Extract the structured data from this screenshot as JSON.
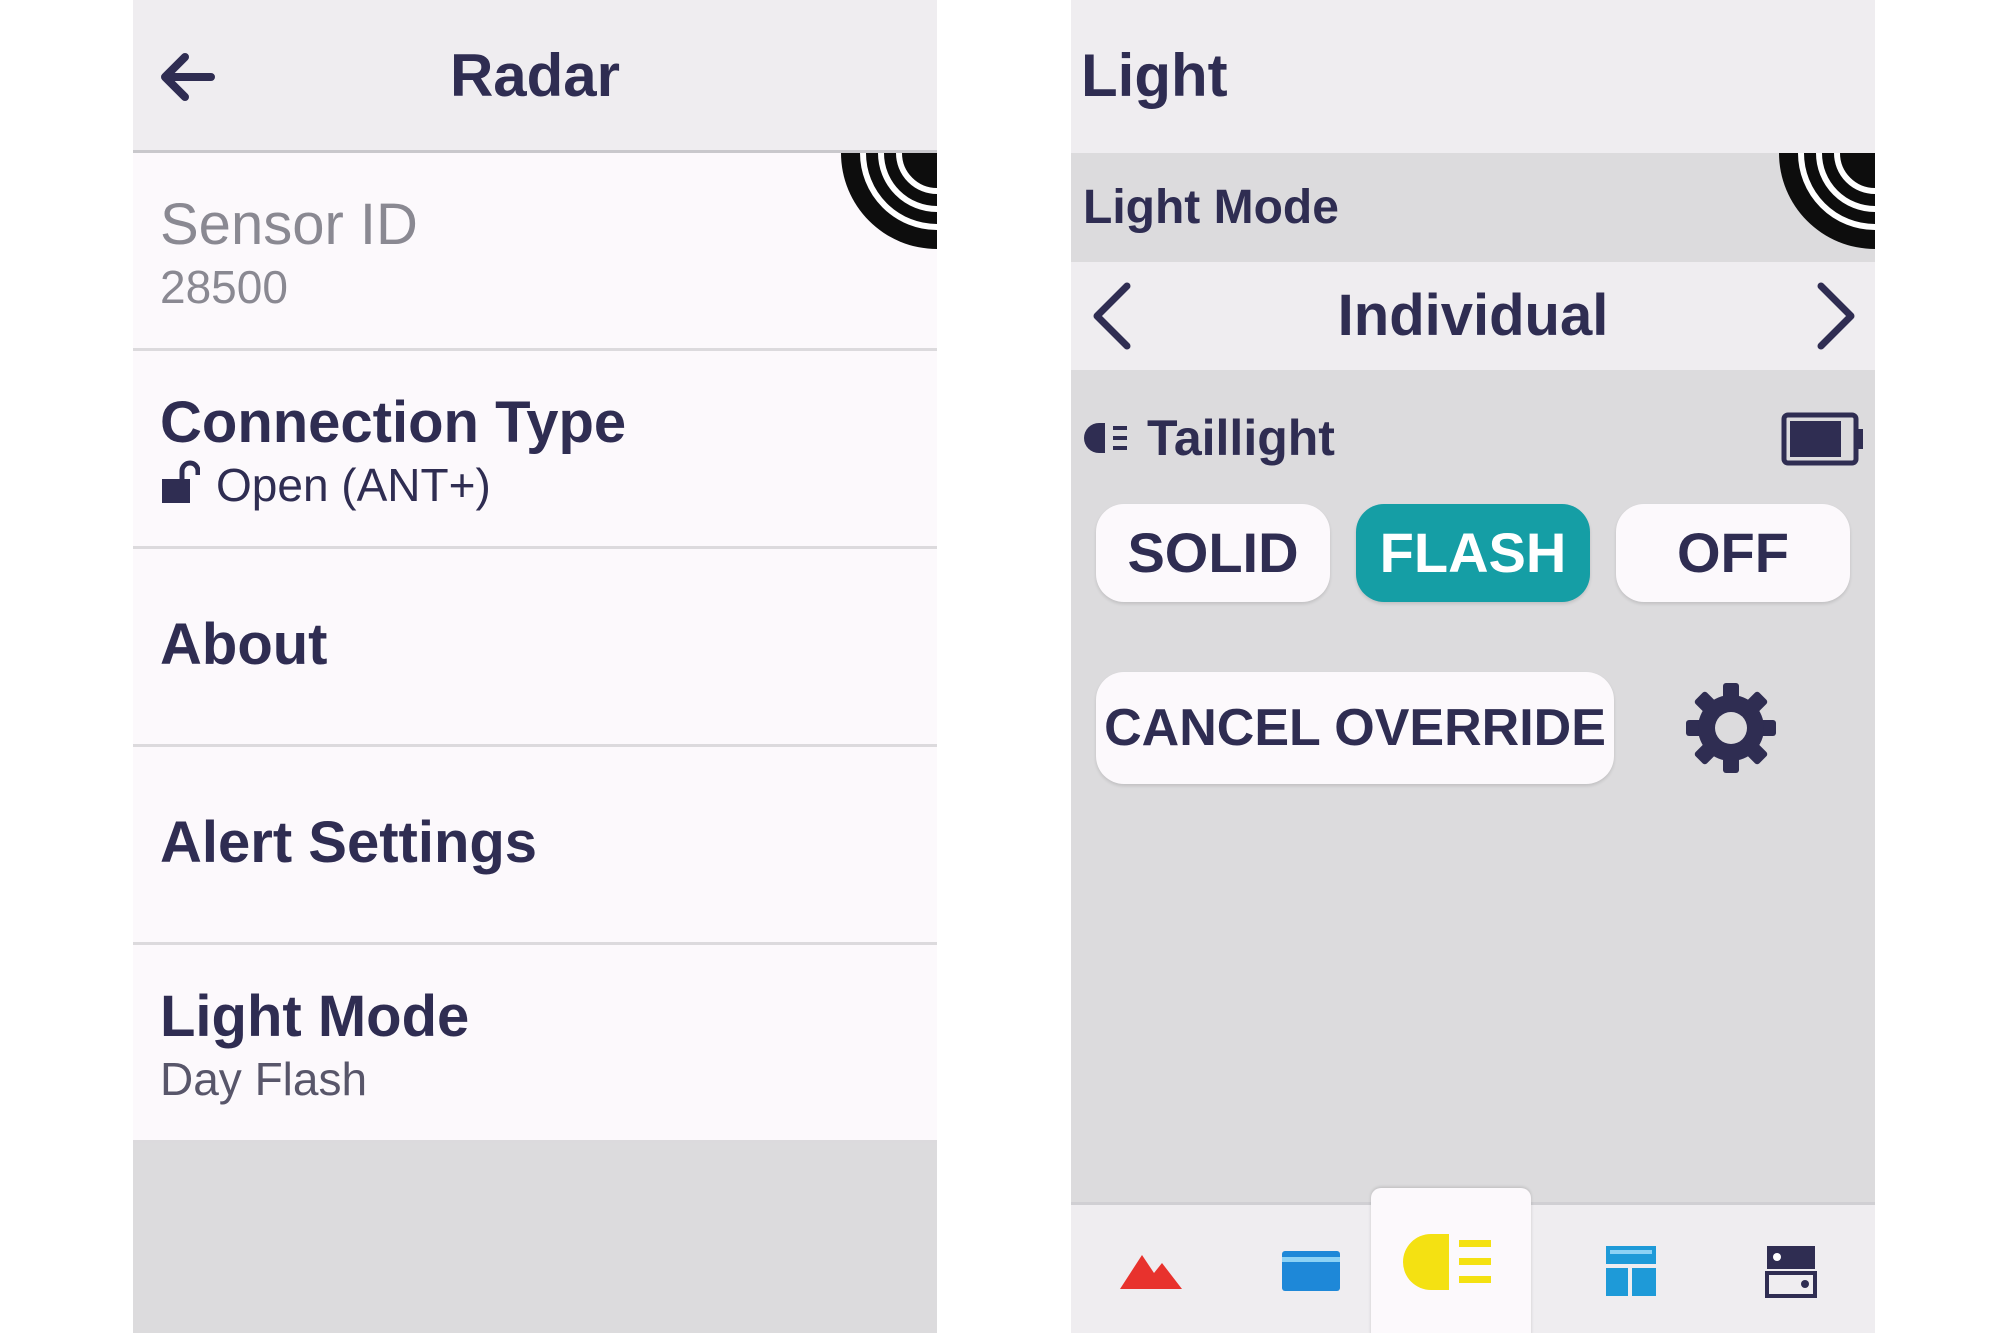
{
  "left": {
    "header": {
      "title": "Radar",
      "back_icon": "back-arrow-icon"
    },
    "rows": [
      {
        "title": "Sensor ID",
        "subtitle": "28500",
        "enabled": false
      },
      {
        "title": "Connection Type",
        "subtitle": "Open (ANT+)",
        "subtitle_icon": "unlock-icon"
      },
      {
        "title": "About"
      },
      {
        "title": "Alert Settings"
      },
      {
        "title": "Light Mode",
        "subtitle": "Day Flash"
      }
    ],
    "corner_icon": "radar-signal-icon"
  },
  "right": {
    "header": {
      "title": "Light"
    },
    "mode_bar": {
      "label": "Light Mode"
    },
    "selector": {
      "value": "Individual",
      "prev_icon": "chevron-left-icon",
      "next_icon": "chevron-right-icon"
    },
    "taillight": {
      "label": "Taillight",
      "icon": "taillight-icon",
      "battery_icon": "battery-icon",
      "battery_level": 0.85
    },
    "buttons": {
      "solid": "SOLID",
      "flash": "FLASH",
      "off": "OFF",
      "cancel": "CANCEL OVERRIDE",
      "active": "FLASH"
    },
    "bottom_nav": {
      "items": [
        "mountain-icon",
        "card-icon",
        "headlight-icon",
        "layout-icon",
        "device-icon"
      ],
      "active": "headlight-icon"
    },
    "colors": {
      "accent": "#159ea5",
      "text": "#2f2d52",
      "mountain": "#e8322d",
      "card": "#1e88d8",
      "headlight": "#f4e112"
    }
  }
}
